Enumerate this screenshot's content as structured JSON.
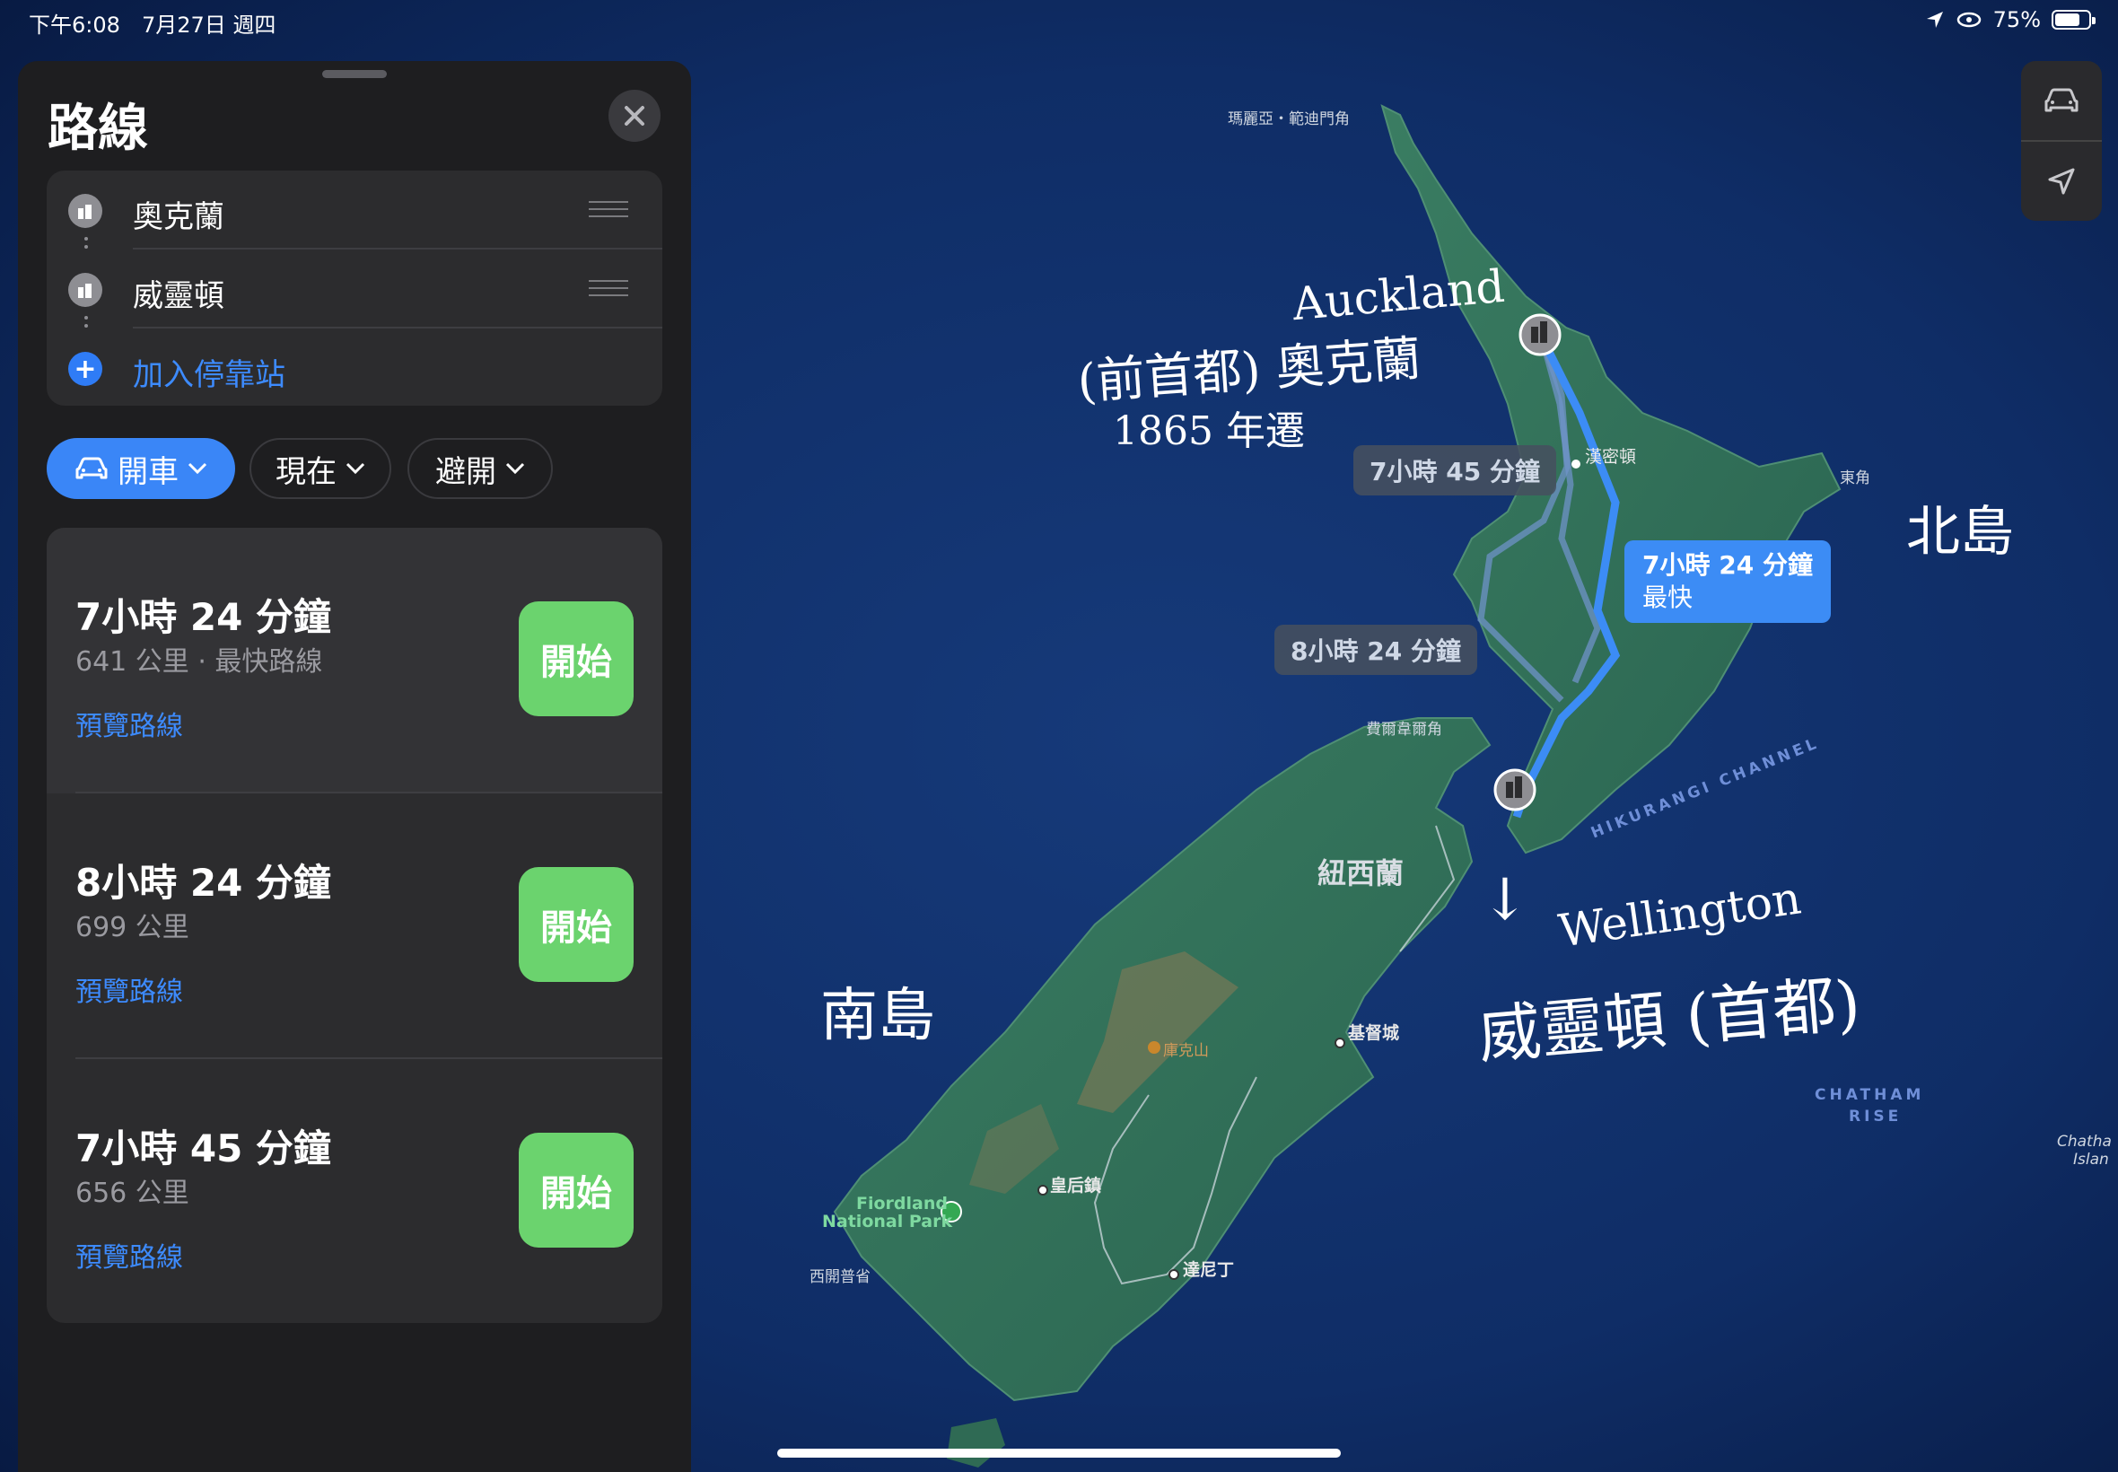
{
  "status_bar": {
    "time": "下午6:08",
    "date": "7月27日 週四",
    "battery": "75%",
    "battery_level": 0.75
  },
  "panel": {
    "title": "路線",
    "stops": [
      {
        "label": "奧克蘭",
        "icon": "city-icon"
      },
      {
        "label": "威靈頓",
        "icon": "city-icon"
      }
    ],
    "add_stop": "加入停靠站",
    "filters": {
      "mode": "開車",
      "depart": "現在",
      "avoid": "避開"
    },
    "routes": [
      {
        "time": "7小時 24 分鐘",
        "meta": "641 公里 · 最快路線",
        "preview": "預覽路線",
        "go": "開始"
      },
      {
        "time": "8小時 24 分鐘",
        "meta": "699 公里",
        "preview": "預覽路線",
        "go": "開始"
      },
      {
        "time": "7小時 45 分鐘",
        "meta": "656 公里",
        "preview": "預覽路線",
        "go": "開始"
      }
    ]
  },
  "map": {
    "labels": {
      "cape_north": "瑪麗亞・範迪門角",
      "hamilton": "漢密頓",
      "east_cape": "東角",
      "cape_farewell": "費爾韋爾角",
      "nz": "紐西蘭",
      "christchurch": "基督城",
      "mt_cook": "庫克山",
      "queenstown": "皇后鎮",
      "fiordland_1": "Fiordland",
      "fiordland_2": "National Park",
      "dunedin": "達尼丁",
      "west_cape": "西開普省",
      "hikurangi": "HIKURANGI CHANNEL",
      "chatham_1": "CHATHAM",
      "chatham_2": "RISE",
      "chatham_islands_1": "Chatha",
      "chatham_islands_2": "Islan"
    },
    "callouts": {
      "alt1": "7小時 45 分鐘",
      "alt2": "8小時 24 分鐘",
      "fastest_time": "7小時 24 分鐘",
      "fastest_tag": "最快"
    },
    "handwriting": {
      "auckland_en": "Auckland",
      "auckland_zh": "(前首都) 奧克蘭",
      "year": "1865 年遷",
      "north_island": "北島",
      "south_island": "南島",
      "wellington_en": "Wellington",
      "wellington_zh": "威靈頓 (首都)",
      "arrow": "↓"
    }
  },
  "colors": {
    "accent": "#3a86f7",
    "go_button": "#6bd36e",
    "panel_bg": "#1e1e20",
    "route_line": "#3c8cf5",
    "ocean": "#0b1f4a",
    "land": "#2c6e55"
  }
}
